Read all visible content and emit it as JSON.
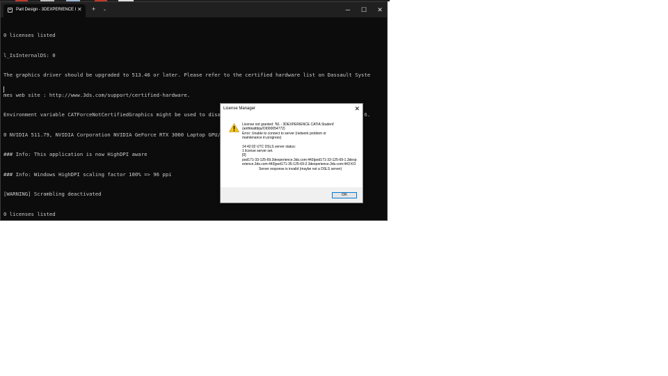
{
  "terminal": {
    "tab_title": "Part Design - 3DEXPERIENCE I",
    "tab_close_glyph": "✕",
    "new_tab_glyph": "+",
    "dropdown_glyph": "⌄",
    "window_controls": {
      "minimize": "─",
      "maximize": "☐",
      "close": "✕"
    },
    "lines": [
      "0 licenses listed",
      "l_IsInternalDS: 0",
      "The graphics driver should be upgraded to 513.46 or later. Please refer to the certified hardware list on Dassault Syste",
      "mes web site : http://www.3ds.com/support/certified-hardware.",
      "Environment variable CATForceNotCertifiedGraphics might be used to disable the message box.[RELEASE]     : OpenGL : 4.6.",
      "0 NVIDIA 511.79, NVIDIA Corporation NVIDIA GeForce RTX 3060 Laptop GPU/PCIe/SSE2",
      "### Info: This application is now HighDPI aware",
      "### Info: Windows HighDPI scaling factor 100% => 96 ppi",
      "[WARNING] Scrambling deactivated",
      "0 licenses listed"
    ],
    "colors": {
      "background": "#0c0c0c",
      "titlebar": "#202020",
      "text": "#cccccc"
    }
  },
  "dialog": {
    "title": "License Manager",
    "close_glyph": "✕",
    "icon": "warning-icon",
    "message": {
      "line1": "License not granted: 'N1 - 3DEXPERIENCE CATIA Student'",
      "line2": "(anthikattbiju/OI000054772)",
      "line3": "Error:  Unable to connect to server (network problem or",
      "line4": "maintenance in progress)",
      "status_line": "14:42:02 UTC DSLS server  status:",
      "server_count": "1 license server  set.",
      "index": "[0]",
      "server_address": "pod171-33-125-69.3dexperience.3ds.com:443|pod171-33-125-69-1.3dexperience.3ds.com:443|pod171-35-125-69-2.3dexperience.3ds.com:443 KO",
      "response": "Server response is invalid (maybe not a DSLS server)"
    },
    "ok_label": "OK",
    "colors": {
      "accent": "#0078d4",
      "warning": "#f5c518"
    }
  }
}
